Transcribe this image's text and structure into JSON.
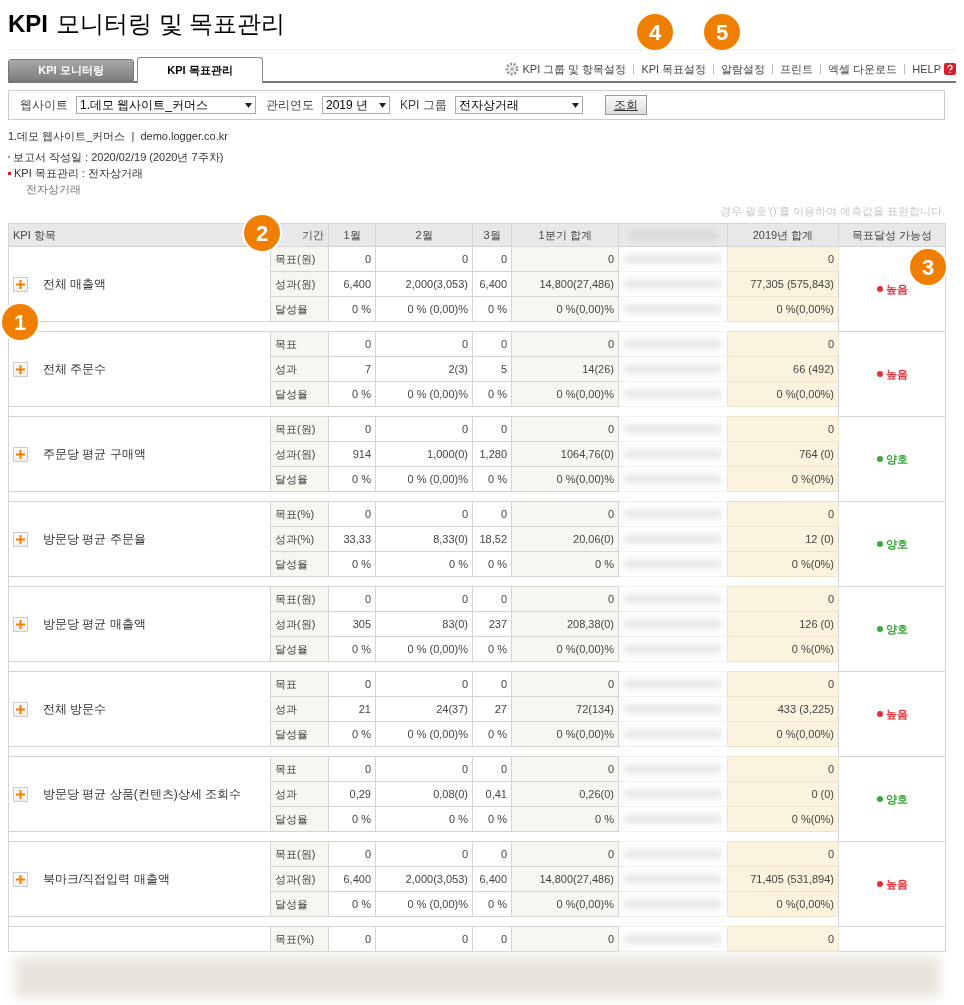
{
  "title": {
    "bold": "KPI",
    "rest": "모니터링 및 목표관리"
  },
  "tabs": [
    {
      "label": "KPI 모니터링",
      "selected": false
    },
    {
      "label": "KPI 목표관리",
      "selected": true
    }
  ],
  "top_links": [
    "KPI 그룹 및 항목설정",
    "KPI 목표설정",
    "알람설정",
    "프린트",
    "엑셀 다운로드",
    "HELP"
  ],
  "filters": [
    {
      "label": "웹사이트",
      "value": "1.데모 웹사이트_커머스"
    },
    {
      "label": "관리연도",
      "value": "2019 년"
    },
    {
      "label": "KPI 그룹",
      "value": "전자상거래"
    }
  ],
  "search_button": "조회",
  "site_info": "1.데모 웹사이트_커머스  |  demo.logger.co.kr",
  "report_date": "보고서 작성일 : 2020/02/19 (2020년 7주차)",
  "report_group": "KPI 목표관리 : 전자상거래",
  "report_subgroup": "전자상거래",
  "note": "경우 괄호'()'를 이용하여 예측값을 표현합니다.",
  "table": {
    "columns": [
      "KPI 항목",
      "기간",
      "1월",
      "2월",
      "3월",
      "1분기 합계",
      "2019년 합계",
      "목표달성 가능성"
    ],
    "rows": [
      {
        "kind": "full",
        "name": "전체 매출액",
        "status": "높음",
        "color": "#e0303a",
        "metrics": [
          {
            "label": "목표(원)",
            "values": [
              "0",
              "0",
              "0",
              "0",
              "0"
            ]
          },
          {
            "label": "성과(원)",
            "values": [
              "6,400",
              "2,000(3,053)",
              "6,400",
              "14,800(27,486)",
              "77,305 (575,843)"
            ]
          },
          {
            "label": "달성율",
            "values": [
              "0 %",
              "0 % (0,00)%",
              "0 %",
              "0 %(0,00)%",
              "0 %(0,00%)"
            ]
          }
        ]
      },
      {
        "kind": "full",
        "name": "전체 주문수",
        "status": "높음",
        "color": "#e0303a",
        "metrics": [
          {
            "label": "목표",
            "values": [
              "0",
              "0",
              "0",
              "0",
              "0"
            ]
          },
          {
            "label": "성과",
            "values": [
              "7",
              "2(3)",
              "5",
              "14(26)",
              "66 (492)"
            ]
          },
          {
            "label": "달성율",
            "values": [
              "0 %",
              "0 % (0,00)%",
              "0 %",
              "0 %(0,00)%",
              "0 %(0,00%)"
            ]
          }
        ]
      },
      {
        "kind": "full",
        "name": "주문당 평균 구매액",
        "status": "양호",
        "color": "#3aa83a",
        "metrics": [
          {
            "label": "목표(원)",
            "values": [
              "0",
              "0",
              "0",
              "0",
              "0"
            ]
          },
          {
            "label": "성과(원)",
            "values": [
              "914",
              "1,000(0)",
              "1,280",
              "1064,76(0)",
              "764 (0)"
            ]
          },
          {
            "label": "달성율",
            "values": [
              "0 %",
              "0 % (0,00)%",
              "0 %",
              "0 %(0,00)%",
              "0 %(0%)"
            ]
          }
        ]
      },
      {
        "kind": "full",
        "name": "방문당 평균 주문율",
        "status": "양호",
        "color": "#3aa83a",
        "metrics": [
          {
            "label": "목표(%)",
            "values": [
              "0",
              "0",
              "0",
              "0",
              "0"
            ]
          },
          {
            "label": "성과(%)",
            "values": [
              "33,33",
              "8,33(0)",
              "18,52",
              "20,06(0)",
              "12 (0)"
            ]
          },
          {
            "label": "달성율",
            "values": [
              "0 %",
              "0 %",
              "0 %",
              "0 %",
              "0 %(0%)"
            ]
          }
        ]
      },
      {
        "kind": "full",
        "name": "방문당 평균 매출액",
        "status": "양호",
        "color": "#3aa83a",
        "metrics": [
          {
            "label": "목표(원)",
            "values": [
              "0",
              "0",
              "0",
              "0",
              "0"
            ]
          },
          {
            "label": "성과(원)",
            "values": [
              "305",
              "83(0)",
              "237",
              "208,38(0)",
              "126 (0)"
            ]
          },
          {
            "label": "달성율",
            "values": [
              "0 %",
              "0 % (0,00)%",
              "0 %",
              "0 %(0,00)%",
              "0 %(0%)"
            ]
          }
        ]
      },
      {
        "kind": "full",
        "name": "전체 방문수",
        "status": "높음",
        "color": "#e0303a",
        "metrics": [
          {
            "label": "목표",
            "values": [
              "0",
              "0",
              "0",
              "0",
              "0"
            ]
          },
          {
            "label": "성과",
            "values": [
              "21",
              "24(37)",
              "27",
              "72(134)",
              "433 (3,225)"
            ]
          },
          {
            "label": "달성율",
            "values": [
              "0 %",
              "0 % (0,00)%",
              "0 %",
              "0 %(0,00)%",
              "0 %(0,00%)"
            ]
          }
        ]
      },
      {
        "kind": "full",
        "name": "방문당 평균 상품(컨텐츠)상세 조회수",
        "status": "양호",
        "color": "#3aa83a",
        "metrics": [
          {
            "label": "목표",
            "values": [
              "0",
              "0",
              "0",
              "0",
              "0"
            ]
          },
          {
            "label": "성과",
            "values": [
              "0,29",
              "0,08(0)",
              "0,41",
              "0,26(0)",
              "0 (0)"
            ]
          },
          {
            "label": "달성율",
            "values": [
              "0 %",
              "0 %",
              "0 %",
              "0 %",
              "0 %(0%)"
            ]
          }
        ]
      },
      {
        "kind": "full",
        "name": "북마크/직접입력 매출액",
        "status": "높음",
        "color": "#e0303a",
        "metrics": [
          {
            "label": "목표(원)",
            "values": [
              "0",
              "0",
              "0",
              "0",
              "0"
            ]
          },
          {
            "label": "성과(원)",
            "values": [
              "6,400",
              "2,000(3,053)",
              "6,400",
              "14,800(27,486)",
              "71,405 (531,894)"
            ]
          },
          {
            "label": "달성율",
            "values": [
              "0 %",
              "0 % (0,00)%",
              "0 %",
              "0 %(0,00)%",
              "0 %(0,00%)"
            ]
          }
        ]
      },
      {
        "kind": "partial",
        "metrics": [
          {
            "label": "목표(%)",
            "values": [
              "0",
              "0",
              "0",
              "0",
              "0"
            ]
          }
        ]
      }
    ]
  },
  "callouts": [
    "1",
    "2",
    "3",
    "4",
    "5"
  ]
}
